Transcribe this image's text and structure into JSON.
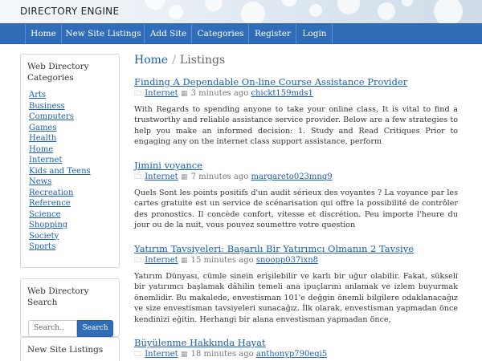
{
  "site": {
    "title": "DIRECTORY ENGINE"
  },
  "nav": {
    "items": [
      {
        "label": "Home"
      },
      {
        "label": "New Site Listings"
      },
      {
        "label": "Add Site"
      },
      {
        "label": "Categories"
      },
      {
        "label": "Register"
      },
      {
        "label": "Login"
      }
    ]
  },
  "sidebar": {
    "categories_title": "Web Directory Categories",
    "categories": [
      "Arts",
      "Business",
      "Computers",
      "Games",
      "Health",
      "Home",
      "Internet",
      "Kids and Teens",
      "News",
      "Recreation",
      "Reference",
      "Science",
      "Shopping",
      "Society",
      "Sports"
    ],
    "search_title": "Web Directory Search",
    "search_placeholder": "Search..",
    "search_button": "Search",
    "new_listings_title": "New Site Listings"
  },
  "breadcrumb": {
    "home": "Home",
    "separator": "/",
    "current": "Listings"
  },
  "listings": [
    {
      "title": "Finding A Dependable On-line Course Assistance Provider",
      "category": "Internet",
      "time": "3 minutes ago",
      "user": "chickt159mds1",
      "description": "With Regards to spending anyone to take your online class, It is vital to find a trustworthy and reliable assistance service provider. Below are a few strategies to help you make an informed decision: 1. Study and Read Critiques Prior to engaging any on the internet class support assistance, perform"
    },
    {
      "title": "Jimini voyance",
      "category": "Internet",
      "time": "7 minutes ago",
      "user": "margareto023mnq9",
      "description": "Quels Sont les points positifs d'un audit sérieux des voyantes ? La voyance par les cartes gratuite est un service de scénarisation qui offre la possibilité de contrôler des pronostics. Il concède confort, vitesse et discrétion. Peu importe l'heure du jour ou de la nuit, vous pouvez soumettre votre question"
    },
    {
      "title": "Yatırım Tavsiyeleri: Başarılı Bir Yatırımcı Olmanın 2 Tavsiye",
      "category": "Internet",
      "time": "15 minutes ago",
      "user": "snoopp037ixn8",
      "description": "Yatırım Dünyası, cümle sinein erişilebilir ve karlı bir uğur olabilir. Fakat, sükseli bir yatırımcı başlamak dâhilin temeli ana ipuçlarını anlamak ve izlem buyurmak önemlidir. Bu makalede, envestisman 101'e değgin önemli bilgilere odaklanacağız ve size envestisman tavsiyeleri sunacağız. İlk olarak, envestisman yapmadan önce kendinizi eğitin. Herhangi bir alana envestisman yapmadan önce,"
    },
    {
      "title": "Büyülenme Hakkında Hayat",
      "category": "Internet",
      "time": "18 minutes ago",
      "user": "anthonyp790eqi5",
      "description": ""
    }
  ]
}
